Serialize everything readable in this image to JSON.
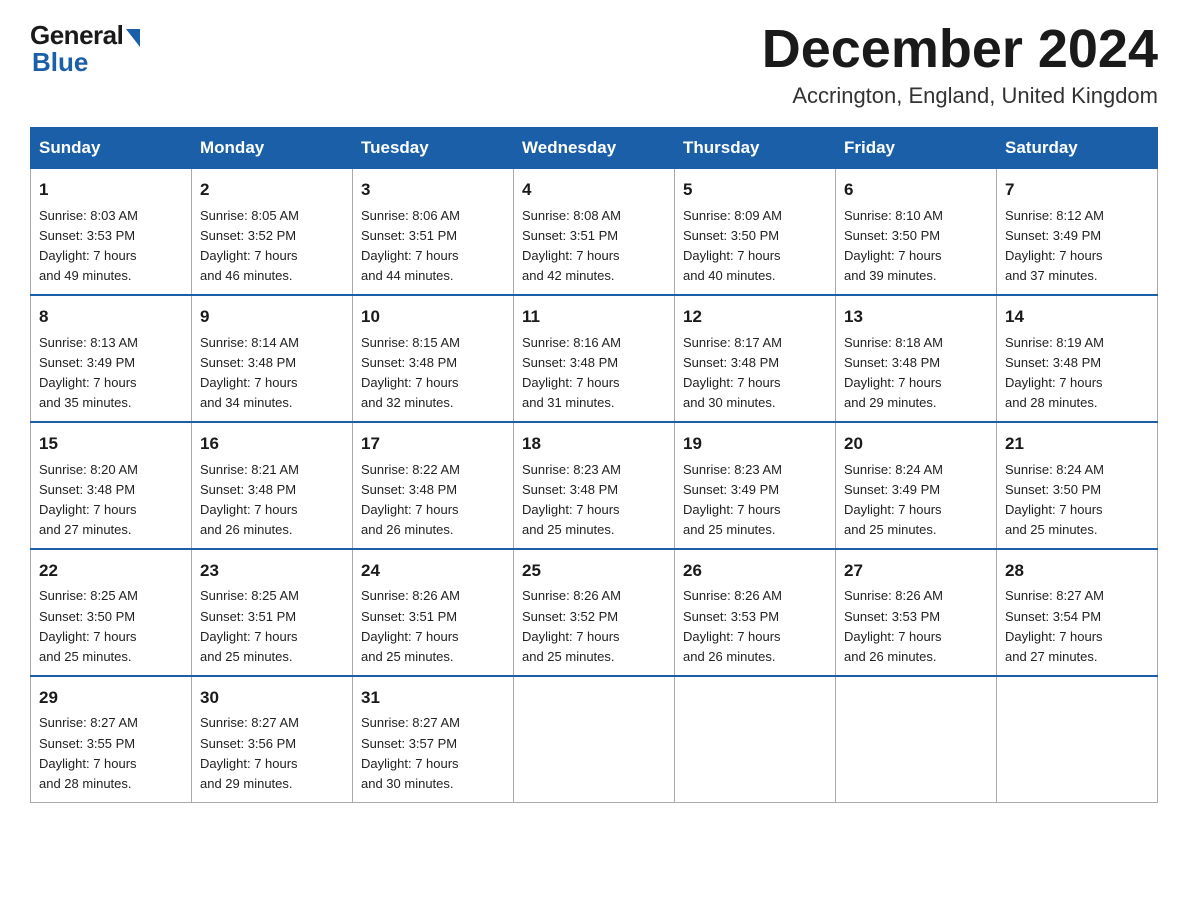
{
  "logo": {
    "general": "General",
    "blue": "Blue"
  },
  "header": {
    "month": "December 2024",
    "location": "Accrington, England, United Kingdom"
  },
  "weekdays": [
    "Sunday",
    "Monday",
    "Tuesday",
    "Wednesday",
    "Thursday",
    "Friday",
    "Saturday"
  ],
  "weeks": [
    [
      {
        "day": "1",
        "sunrise": "Sunrise: 8:03 AM",
        "sunset": "Sunset: 3:53 PM",
        "daylight": "Daylight: 7 hours",
        "daylight2": "and 49 minutes."
      },
      {
        "day": "2",
        "sunrise": "Sunrise: 8:05 AM",
        "sunset": "Sunset: 3:52 PM",
        "daylight": "Daylight: 7 hours",
        "daylight2": "and 46 minutes."
      },
      {
        "day": "3",
        "sunrise": "Sunrise: 8:06 AM",
        "sunset": "Sunset: 3:51 PM",
        "daylight": "Daylight: 7 hours",
        "daylight2": "and 44 minutes."
      },
      {
        "day": "4",
        "sunrise": "Sunrise: 8:08 AM",
        "sunset": "Sunset: 3:51 PM",
        "daylight": "Daylight: 7 hours",
        "daylight2": "and 42 minutes."
      },
      {
        "day": "5",
        "sunrise": "Sunrise: 8:09 AM",
        "sunset": "Sunset: 3:50 PM",
        "daylight": "Daylight: 7 hours",
        "daylight2": "and 40 minutes."
      },
      {
        "day": "6",
        "sunrise": "Sunrise: 8:10 AM",
        "sunset": "Sunset: 3:50 PM",
        "daylight": "Daylight: 7 hours",
        "daylight2": "and 39 minutes."
      },
      {
        "day": "7",
        "sunrise": "Sunrise: 8:12 AM",
        "sunset": "Sunset: 3:49 PM",
        "daylight": "Daylight: 7 hours",
        "daylight2": "and 37 minutes."
      }
    ],
    [
      {
        "day": "8",
        "sunrise": "Sunrise: 8:13 AM",
        "sunset": "Sunset: 3:49 PM",
        "daylight": "Daylight: 7 hours",
        "daylight2": "and 35 minutes."
      },
      {
        "day": "9",
        "sunrise": "Sunrise: 8:14 AM",
        "sunset": "Sunset: 3:48 PM",
        "daylight": "Daylight: 7 hours",
        "daylight2": "and 34 minutes."
      },
      {
        "day": "10",
        "sunrise": "Sunrise: 8:15 AM",
        "sunset": "Sunset: 3:48 PM",
        "daylight": "Daylight: 7 hours",
        "daylight2": "and 32 minutes."
      },
      {
        "day": "11",
        "sunrise": "Sunrise: 8:16 AM",
        "sunset": "Sunset: 3:48 PM",
        "daylight": "Daylight: 7 hours",
        "daylight2": "and 31 minutes."
      },
      {
        "day": "12",
        "sunrise": "Sunrise: 8:17 AM",
        "sunset": "Sunset: 3:48 PM",
        "daylight": "Daylight: 7 hours",
        "daylight2": "and 30 minutes."
      },
      {
        "day": "13",
        "sunrise": "Sunrise: 8:18 AM",
        "sunset": "Sunset: 3:48 PM",
        "daylight": "Daylight: 7 hours",
        "daylight2": "and 29 minutes."
      },
      {
        "day": "14",
        "sunrise": "Sunrise: 8:19 AM",
        "sunset": "Sunset: 3:48 PM",
        "daylight": "Daylight: 7 hours",
        "daylight2": "and 28 minutes."
      }
    ],
    [
      {
        "day": "15",
        "sunrise": "Sunrise: 8:20 AM",
        "sunset": "Sunset: 3:48 PM",
        "daylight": "Daylight: 7 hours",
        "daylight2": "and 27 minutes."
      },
      {
        "day": "16",
        "sunrise": "Sunrise: 8:21 AM",
        "sunset": "Sunset: 3:48 PM",
        "daylight": "Daylight: 7 hours",
        "daylight2": "and 26 minutes."
      },
      {
        "day": "17",
        "sunrise": "Sunrise: 8:22 AM",
        "sunset": "Sunset: 3:48 PM",
        "daylight": "Daylight: 7 hours",
        "daylight2": "and 26 minutes."
      },
      {
        "day": "18",
        "sunrise": "Sunrise: 8:23 AM",
        "sunset": "Sunset: 3:48 PM",
        "daylight": "Daylight: 7 hours",
        "daylight2": "and 25 minutes."
      },
      {
        "day": "19",
        "sunrise": "Sunrise: 8:23 AM",
        "sunset": "Sunset: 3:49 PM",
        "daylight": "Daylight: 7 hours",
        "daylight2": "and 25 minutes."
      },
      {
        "day": "20",
        "sunrise": "Sunrise: 8:24 AM",
        "sunset": "Sunset: 3:49 PM",
        "daylight": "Daylight: 7 hours",
        "daylight2": "and 25 minutes."
      },
      {
        "day": "21",
        "sunrise": "Sunrise: 8:24 AM",
        "sunset": "Sunset: 3:50 PM",
        "daylight": "Daylight: 7 hours",
        "daylight2": "and 25 minutes."
      }
    ],
    [
      {
        "day": "22",
        "sunrise": "Sunrise: 8:25 AM",
        "sunset": "Sunset: 3:50 PM",
        "daylight": "Daylight: 7 hours",
        "daylight2": "and 25 minutes."
      },
      {
        "day": "23",
        "sunrise": "Sunrise: 8:25 AM",
        "sunset": "Sunset: 3:51 PM",
        "daylight": "Daylight: 7 hours",
        "daylight2": "and 25 minutes."
      },
      {
        "day": "24",
        "sunrise": "Sunrise: 8:26 AM",
        "sunset": "Sunset: 3:51 PM",
        "daylight": "Daylight: 7 hours",
        "daylight2": "and 25 minutes."
      },
      {
        "day": "25",
        "sunrise": "Sunrise: 8:26 AM",
        "sunset": "Sunset: 3:52 PM",
        "daylight": "Daylight: 7 hours",
        "daylight2": "and 25 minutes."
      },
      {
        "day": "26",
        "sunrise": "Sunrise: 8:26 AM",
        "sunset": "Sunset: 3:53 PM",
        "daylight": "Daylight: 7 hours",
        "daylight2": "and 26 minutes."
      },
      {
        "day": "27",
        "sunrise": "Sunrise: 8:26 AM",
        "sunset": "Sunset: 3:53 PM",
        "daylight": "Daylight: 7 hours",
        "daylight2": "and 26 minutes."
      },
      {
        "day": "28",
        "sunrise": "Sunrise: 8:27 AM",
        "sunset": "Sunset: 3:54 PM",
        "daylight": "Daylight: 7 hours",
        "daylight2": "and 27 minutes."
      }
    ],
    [
      {
        "day": "29",
        "sunrise": "Sunrise: 8:27 AM",
        "sunset": "Sunset: 3:55 PM",
        "daylight": "Daylight: 7 hours",
        "daylight2": "and 28 minutes."
      },
      {
        "day": "30",
        "sunrise": "Sunrise: 8:27 AM",
        "sunset": "Sunset: 3:56 PM",
        "daylight": "Daylight: 7 hours",
        "daylight2": "and 29 minutes."
      },
      {
        "day": "31",
        "sunrise": "Sunrise: 8:27 AM",
        "sunset": "Sunset: 3:57 PM",
        "daylight": "Daylight: 7 hours",
        "daylight2": "and 30 minutes."
      },
      null,
      null,
      null,
      null
    ]
  ]
}
